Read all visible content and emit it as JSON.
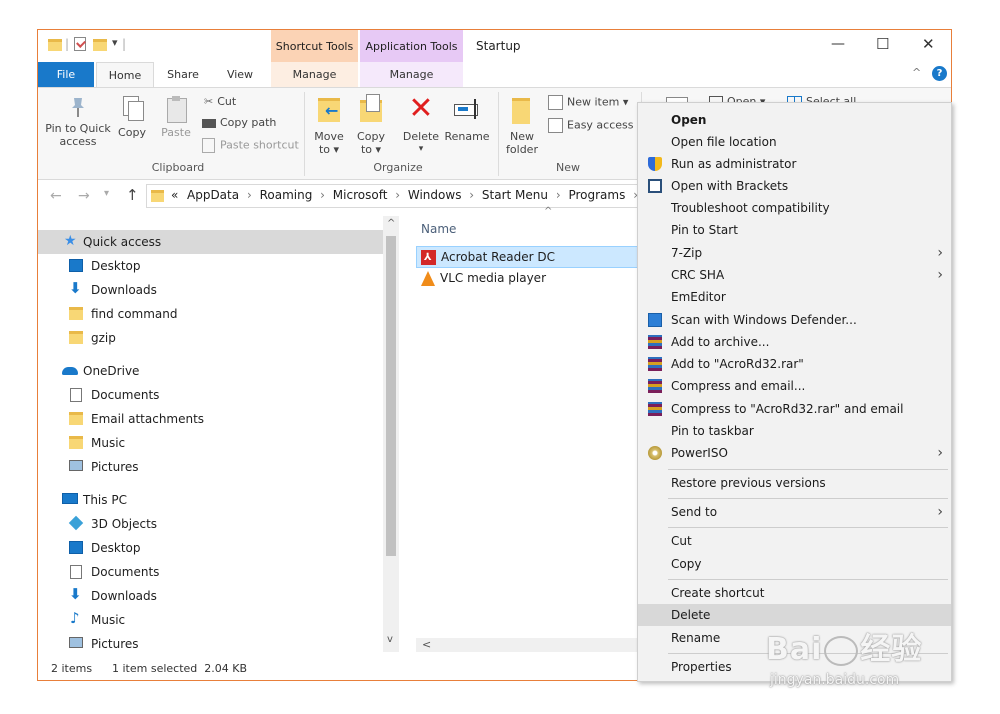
{
  "window": {
    "title": "Startup"
  },
  "titlebar": {
    "ctx_tab_shortcut": "Shortcut Tools",
    "ctx_tab_application": "Application Tools",
    "minimize": "—",
    "maximize": "☐",
    "close": "✕",
    "qat_separator": "|",
    "qat_dropdown": "▾"
  },
  "ribbon_tabs": {
    "file": "File",
    "home": "Home",
    "share": "Share",
    "view": "View",
    "manage1": "Manage",
    "manage2": "Manage",
    "collapse": "^",
    "help": "?"
  },
  "ribbon": {
    "pin_quick_access": "Pin to Quick access",
    "copy": "Copy",
    "paste": "Paste",
    "cut": "Cut",
    "copy_path": "Copy path",
    "paste_shortcut": "Paste shortcut",
    "group_clipboard": "Clipboard",
    "move_to": "Move to ▾",
    "copy_to": "Copy to ▾",
    "delete": "Delete",
    "delete_arrow": "▾",
    "rename": "Rename",
    "group_organize": "Organize",
    "new_folder": "New folder",
    "new_item": "New item ▾",
    "easy_access": "Easy access ▾",
    "group_new": "New",
    "open": "Open ▾",
    "select_all": "Select all"
  },
  "address": {
    "back": "←",
    "forward": "→",
    "recent": "▾",
    "up": "↑",
    "overflow": "«",
    "crumbs": [
      "AppData",
      "Roaming",
      "Microsoft",
      "Windows",
      "Start Menu",
      "Programs",
      "S"
    ],
    "separator": "›"
  },
  "nav": {
    "quick_access": "Quick access",
    "desktop": "Desktop",
    "downloads": "Downloads",
    "find_command": "find command",
    "gzip": "gzip",
    "onedrive": "OneDrive",
    "documents": "Documents",
    "email_attachments": "Email attachments",
    "music": "Music",
    "pictures": "Pictures",
    "this_pc": "This PC",
    "objects3d": "3D Objects",
    "desktop2": "Desktop",
    "documents2": "Documents",
    "downloads2": "Downloads",
    "music2": "Music",
    "pictures2": "Pictures",
    "scroll_up": "^",
    "scroll_down": "v"
  },
  "files": {
    "column_name": "Name",
    "sort_indicator": "^",
    "items": [
      {
        "name": "Acrobat Reader DC",
        "selected": true
      },
      {
        "name": "VLC media player",
        "selected": false
      }
    ],
    "hscroll_left": "<"
  },
  "status": {
    "count": "2 items",
    "selection": "1 item selected  2.04 KB"
  },
  "context_menu": {
    "open": "Open",
    "open_location": "Open file location",
    "run_admin": "Run as administrator",
    "open_brackets": "Open with Brackets",
    "troubleshoot": "Troubleshoot compatibility",
    "pin_start": "Pin to Start",
    "zip7": "7-Zip",
    "crc": "CRC SHA",
    "emeditor": "EmEditor",
    "defender": "Scan with Windows Defender...",
    "add_archive": "Add to archive...",
    "add_rar": "Add to \"AcroRd32.rar\"",
    "compress_email": "Compress and email...",
    "compress_rar_email": "Compress to \"AcroRd32.rar\" and email",
    "pin_taskbar": "Pin to taskbar",
    "poweriso": "PowerISO",
    "restore": "Restore previous versions",
    "send_to": "Send to",
    "cut": "Cut",
    "copy": "Copy",
    "create_shortcut": "Create shortcut",
    "delete": "Delete",
    "rename": "Rename",
    "properties": "Properties",
    "submenu_arrow": "›"
  },
  "watermark": {
    "brand": "Bai",
    "brand2": "经验",
    "url": "jingyan.baidu.com"
  },
  "colors": {
    "accent": "#1979ca",
    "selection": "#cce8ff",
    "frame": "#e87f3a",
    "menu_highlight": "#d8d8d8"
  }
}
